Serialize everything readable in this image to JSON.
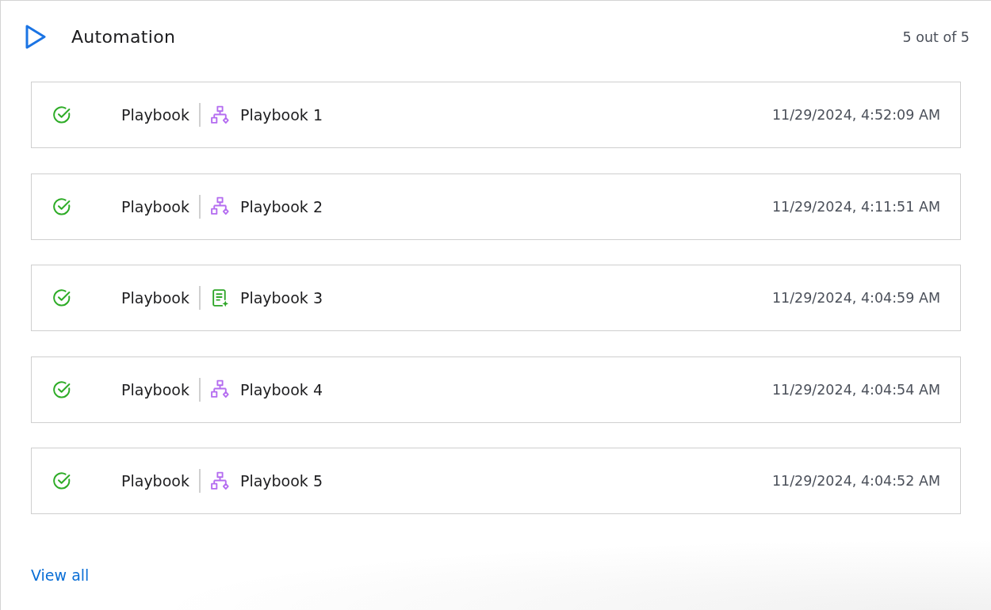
{
  "header": {
    "title": "Automation",
    "count": "5 out of 5"
  },
  "runs": [
    {
      "succeeded": true,
      "type": "Playbook",
      "kind": "flow",
      "name": "Playbook 1",
      "timestamp": "11/29/2024, 4:52:09 AM"
    },
    {
      "succeeded": true,
      "type": "Playbook",
      "kind": "flow",
      "name": "Playbook 2",
      "timestamp": "11/29/2024, 4:11:51 AM"
    },
    {
      "succeeded": true,
      "type": "Playbook",
      "kind": "document",
      "name": "Playbook 3",
      "timestamp": "11/29/2024, 4:04:59 AM"
    },
    {
      "succeeded": true,
      "type": "Playbook",
      "kind": "flow",
      "name": "Playbook 4",
      "timestamp": "11/29/2024, 4:04:54 AM"
    },
    {
      "succeeded": true,
      "type": "Playbook",
      "kind": "flow",
      "name": "Playbook 5",
      "timestamp": "11/29/2024, 4:04:52 AM"
    }
  ],
  "footer": {
    "link": "View all"
  }
}
